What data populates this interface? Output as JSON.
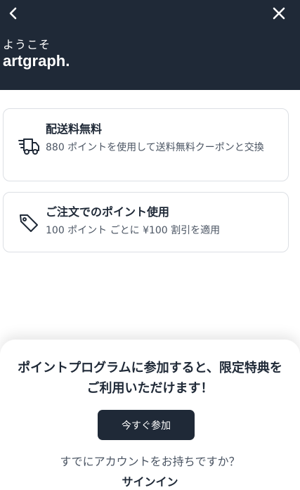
{
  "header": {
    "greeting": "ようこそ",
    "store_name": "artgraph.",
    "back_icon": "chevron-left-icon",
    "close_icon": "close-icon"
  },
  "benefits": [
    {
      "icon": "delivery-truck-icon",
      "title": "配送料無料",
      "description": "880 ポイントを使用して送料無料クーポンと交換"
    },
    {
      "icon": "price-tag-icon",
      "title": "ご注文でのポイント使用",
      "description": "100 ポイント ごとに ¥100 割引を適用"
    }
  ],
  "sheet": {
    "promo_text": "ポイントプログラムに参加すると、限定特典をご利用いただけます！",
    "join_label": "今すぐ参加",
    "account_question": "すでにアカウントをお持ちですか？",
    "signin_label": "サインイン"
  },
  "colors": {
    "header_bg": "#1f2937",
    "button_bg": "#1f2937",
    "card_border": "#dcdfe4"
  }
}
